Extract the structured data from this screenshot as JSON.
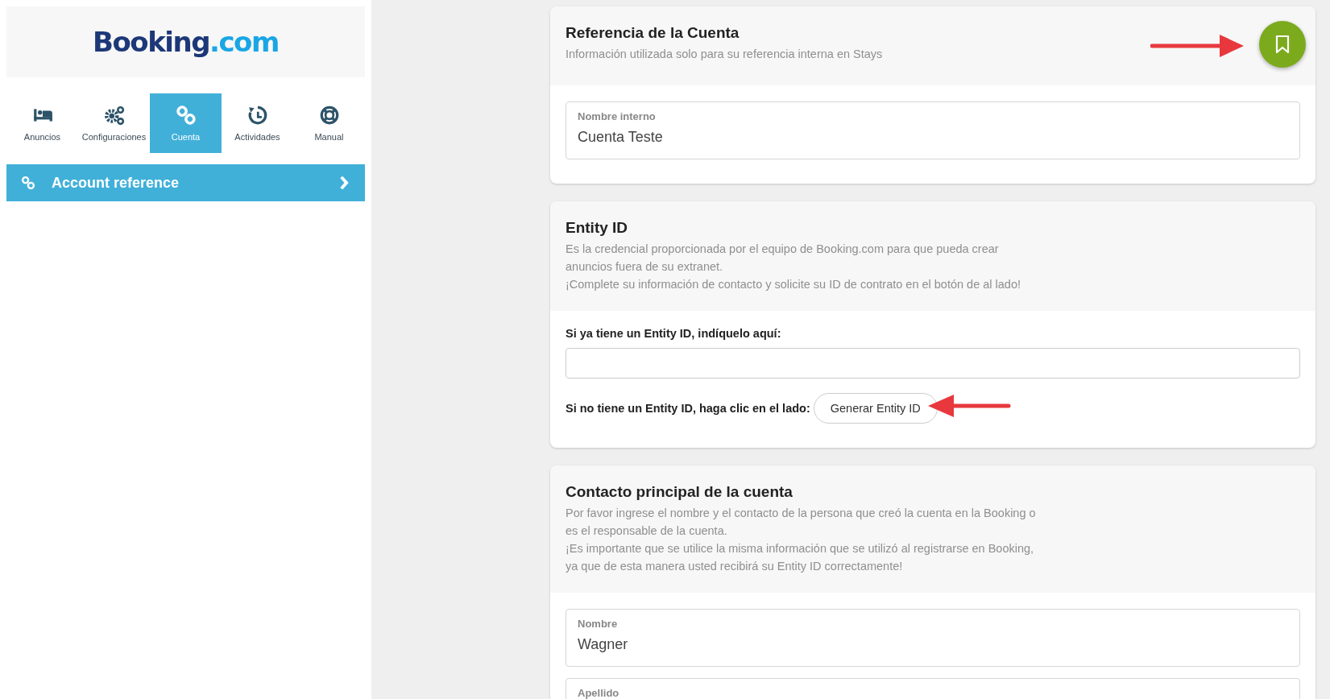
{
  "sidebar": {
    "logo": {
      "main": "Booking",
      "accent": ".com"
    },
    "tabs": [
      {
        "kind": "bed",
        "label": "Anuncios",
        "selected": false
      },
      {
        "kind": "gears",
        "label": "Configuraciones",
        "selected": false
      },
      {
        "kind": "link",
        "label": "Cuenta",
        "selected": true
      },
      {
        "kind": "history",
        "label": "Actividades",
        "selected": false
      },
      {
        "kind": "lifebuoy",
        "label": "Manual",
        "selected": false
      }
    ],
    "menu": [
      {
        "label": "Account reference",
        "selected": true
      }
    ]
  },
  "cards": [
    {
      "title": "Referencia de la Cuenta",
      "description": [
        "Información utilizada solo para su referencia interna en Stays"
      ],
      "save_button": true,
      "items": [
        {
          "kind": "field",
          "label": "Nombre interno",
          "value": "Cuenta Teste"
        }
      ]
    },
    {
      "title": "Entity ID",
      "description": [
        "Es la credencial proporcionada por el equipo de Booking.com para que pueda crear\nanuncios fuera de su extranet.",
        "¡Complete su información de contacto y solicite su ID de contrato en el botón de al lado!"
      ],
      "save_button": false,
      "items": [
        {
          "kind": "labeled_input",
          "label": "Si ya tiene un Entity ID, indíquelo aquí:"
        },
        {
          "kind": "action",
          "label": "Si no tiene un Entity ID, haga clic en el lado:",
          "button": "Generar Entity ID"
        }
      ]
    },
    {
      "title": "Contacto principal de la cuenta",
      "description": [
        "Por favor ingrese el nombre y el contacto de la persona que creó la cuenta en la Booking o\nes el responsable de la cuenta.",
        "¡Es importante que se utilice la misma información que se utilizó al registrarse en Booking,\nya que de esta manera usted recibirá su Entity ID correctamente!"
      ],
      "save_button": false,
      "items": [
        {
          "kind": "field",
          "label": "Nombre",
          "value": "Wagner"
        },
        {
          "kind": "field",
          "label": "Apellido"
        }
      ]
    }
  ]
}
